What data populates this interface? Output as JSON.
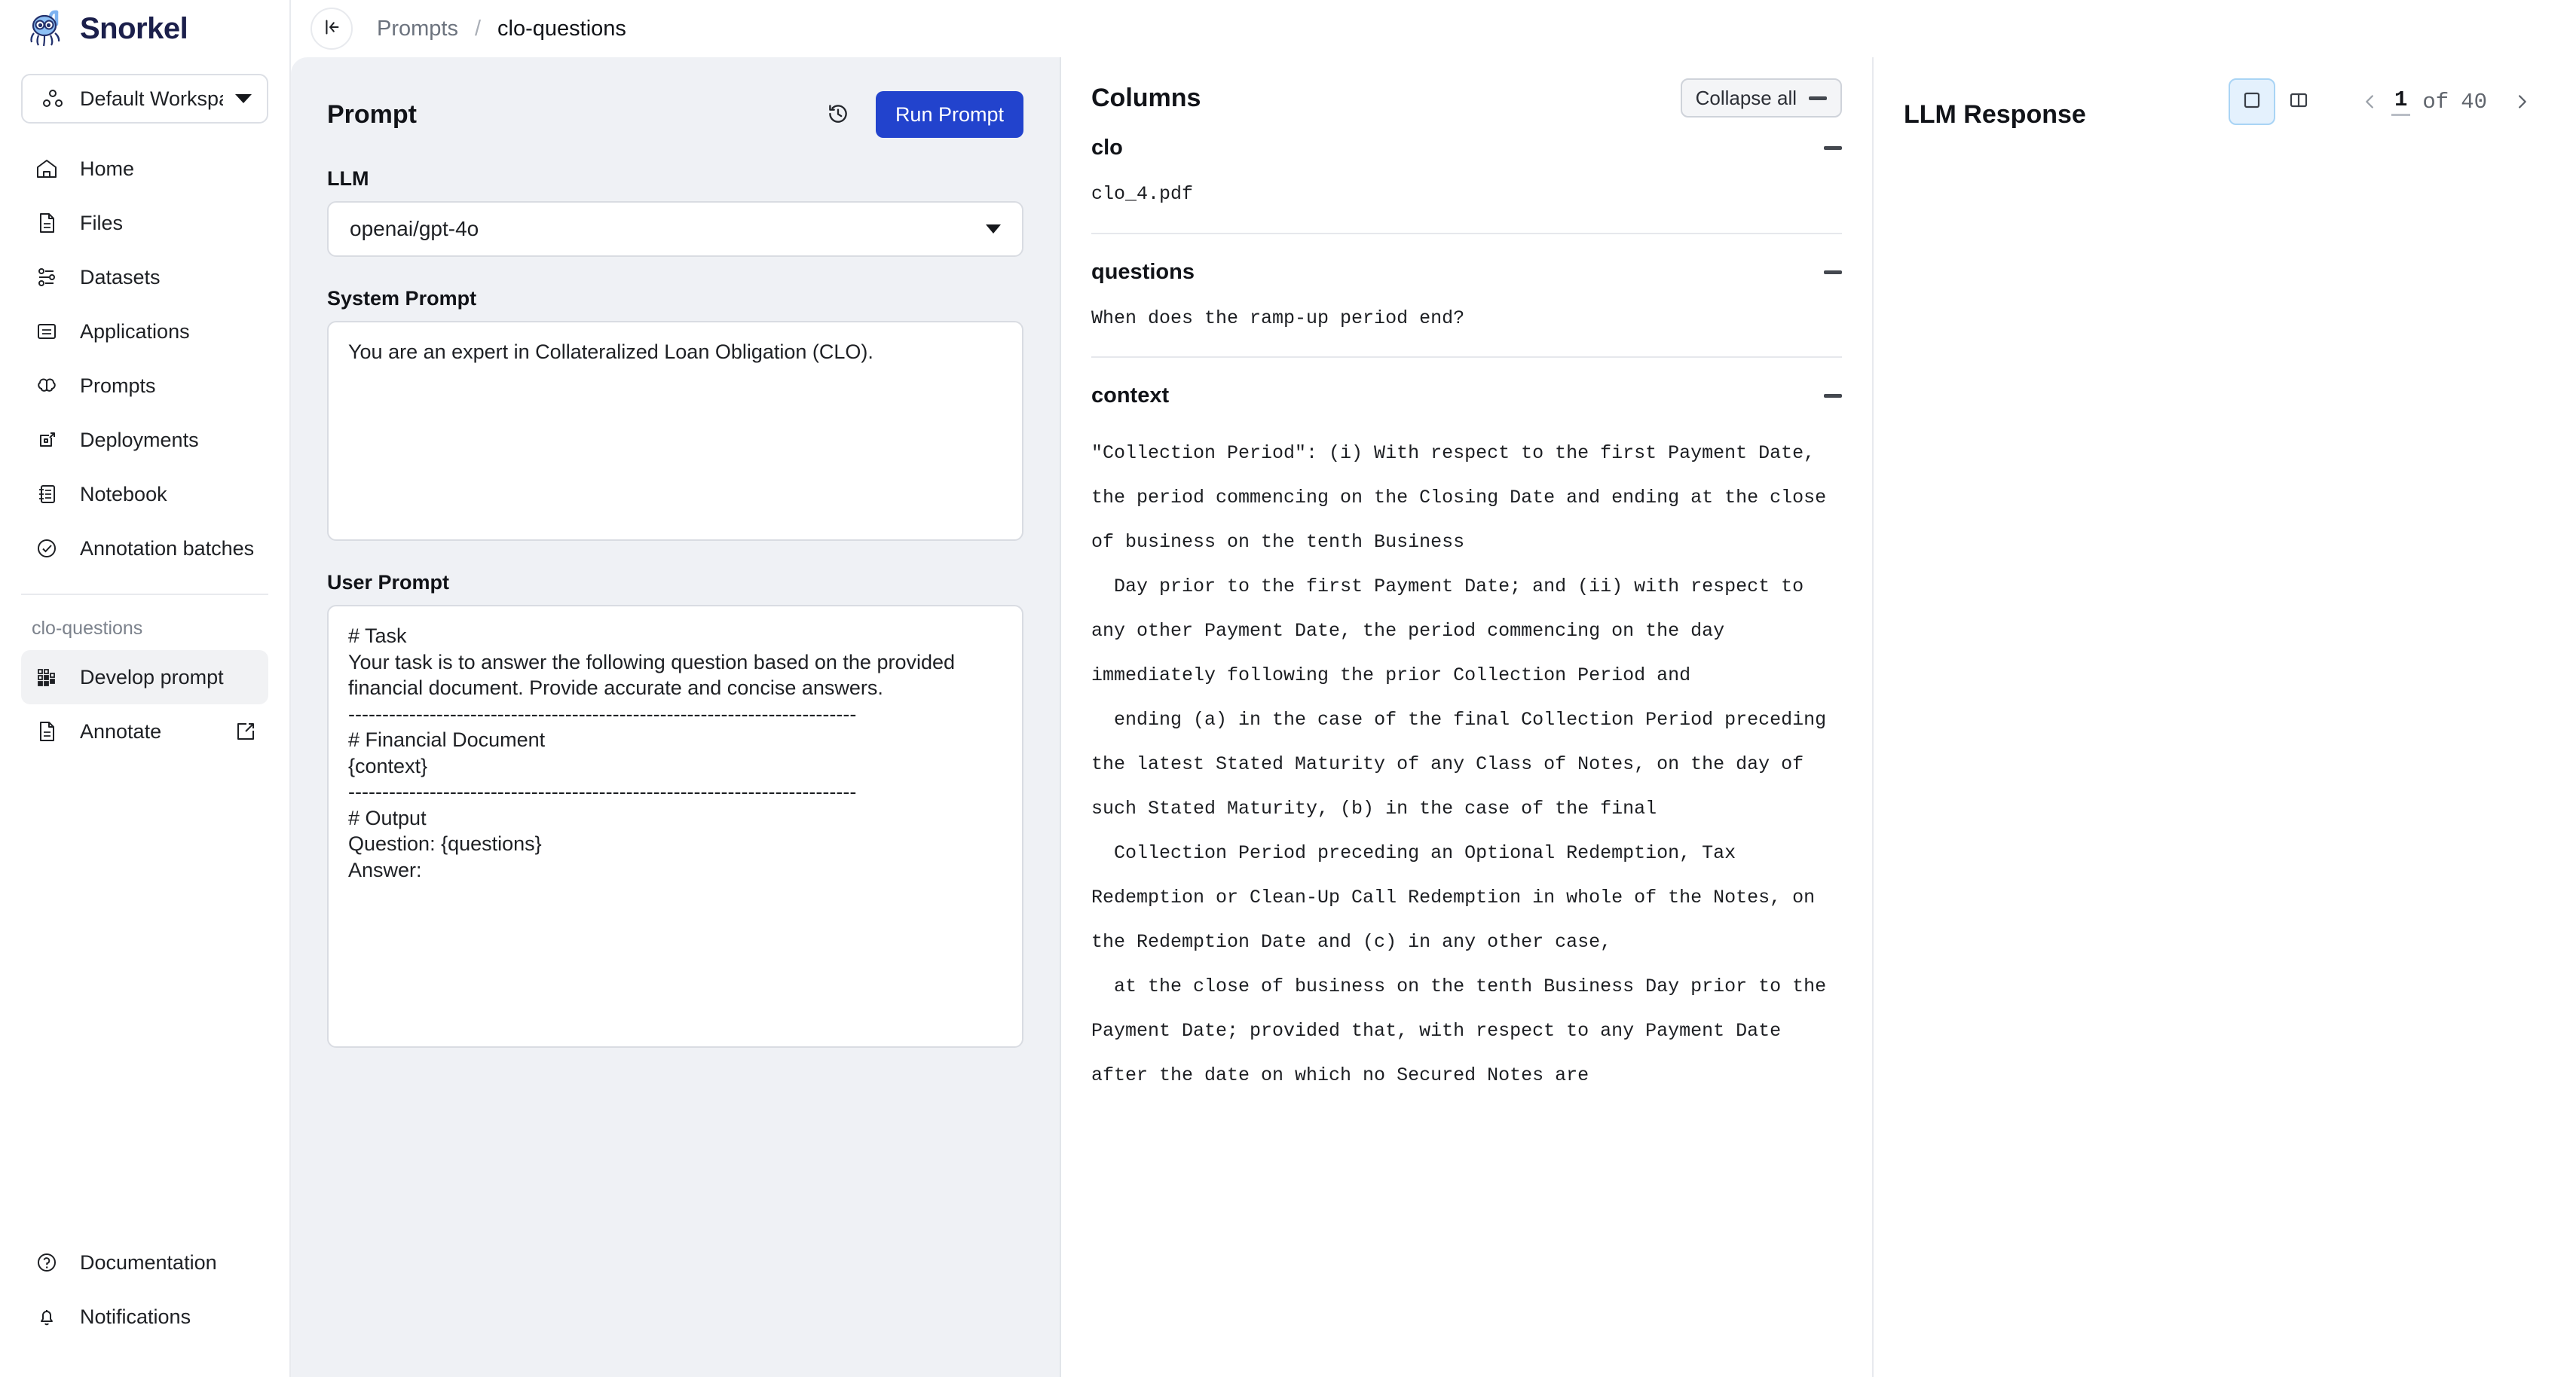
{
  "brand": {
    "name": "Snorkel",
    "logo_icon": "snorkel-octopus-logo"
  },
  "topbar": {
    "back_icon": "collapse-sidebar-icon",
    "breadcrumb": {
      "parent": "Prompts",
      "separator": "/",
      "current": "clo-questions"
    }
  },
  "sidebar": {
    "workspace": {
      "label": "Default Workspace",
      "icon": "workspace-icon"
    },
    "items": [
      {
        "label": "Home",
        "icon": "home-icon"
      },
      {
        "label": "Files",
        "icon": "file-icon"
      },
      {
        "label": "Datasets",
        "icon": "sliders-icon"
      },
      {
        "label": "Applications",
        "icon": "applications-icon"
      },
      {
        "label": "Prompts",
        "icon": "brain-icon"
      },
      {
        "label": "Deployments",
        "icon": "deploy-icon"
      },
      {
        "label": "Notebook",
        "icon": "notebook-icon"
      },
      {
        "label": "Annotation batches",
        "icon": "check-circle-icon"
      }
    ],
    "group_title": "clo-questions",
    "group_items": [
      {
        "label": "Develop prompt",
        "icon": "grid-blocks-icon",
        "active": true
      },
      {
        "label": "Annotate",
        "icon": "file-icon",
        "external": true
      }
    ],
    "bottom_items": [
      {
        "label": "Documentation",
        "icon": "question-circle-icon"
      },
      {
        "label": "Notifications",
        "icon": "bell-icon"
      }
    ]
  },
  "prompt_panel": {
    "title": "Prompt",
    "history_icon": "history-clock-icon",
    "run_label": "Run Prompt",
    "llm_label": "LLM",
    "llm_value": "openai/gpt-4o",
    "system_label": "System Prompt",
    "system_value": "You are an expert in Collateralized Loan Obligation (CLO).",
    "user_label": "User Prompt",
    "user_value": "# Task\nYour task is to answer the following question based on the provided financial document. Provide accurate and concise answers.\n---------------------------------------------------------------------------\n# Financial Document\n{context}\n---------------------------------------------------------------------------\n# Output\nQuestion: {questions}\nAnswer:"
  },
  "view_toolbar": {
    "single_pane_icon": "single-pane-icon",
    "split_pane_icon": "split-pane-icon",
    "prev_icon": "chevron-left-icon",
    "next_icon": "chevron-right-icon",
    "page_current": "1",
    "page_of_label": "of",
    "page_total": "40"
  },
  "columns_panel": {
    "title": "Columns",
    "collapse_all_label": "Collapse all",
    "collapse_icon": "minus-icon",
    "columns": [
      {
        "name": "clo",
        "value": "clo_4.pdf",
        "toggle_icon": "minus-icon",
        "spaced": false
      },
      {
        "name": "questions",
        "value": "When does the ramp-up period end?",
        "toggle_icon": "minus-icon",
        "spaced": false
      },
      {
        "name": "context",
        "toggle_icon": "minus-icon",
        "spaced": true,
        "value": "\"Collection Period\": (i) With respect to the first Payment Date, the period commencing on the Closing Date and ending at the close of business on the tenth Business\n  Day prior to the first Payment Date; and (ii) with respect to any other Payment Date, the period commencing on the day immediately following the prior Collection Period and\n  ending (a) in the case of the final Collection Period preceding the latest Stated Maturity of any Class of Notes, on the day of such Stated Maturity, (b) in the case of the final\n  Collection Period preceding an Optional Redemption, Tax Redemption or Clean-Up Call Redemption in whole of the Notes, on the Redemption Date and (c) in any other case,\n  at the close of business on the tenth Business Day prior to the Payment Date; provided that, with respect to any Payment Date after the date on which no Secured Notes are"
      }
    ]
  },
  "response_panel": {
    "title": "LLM Response"
  }
}
